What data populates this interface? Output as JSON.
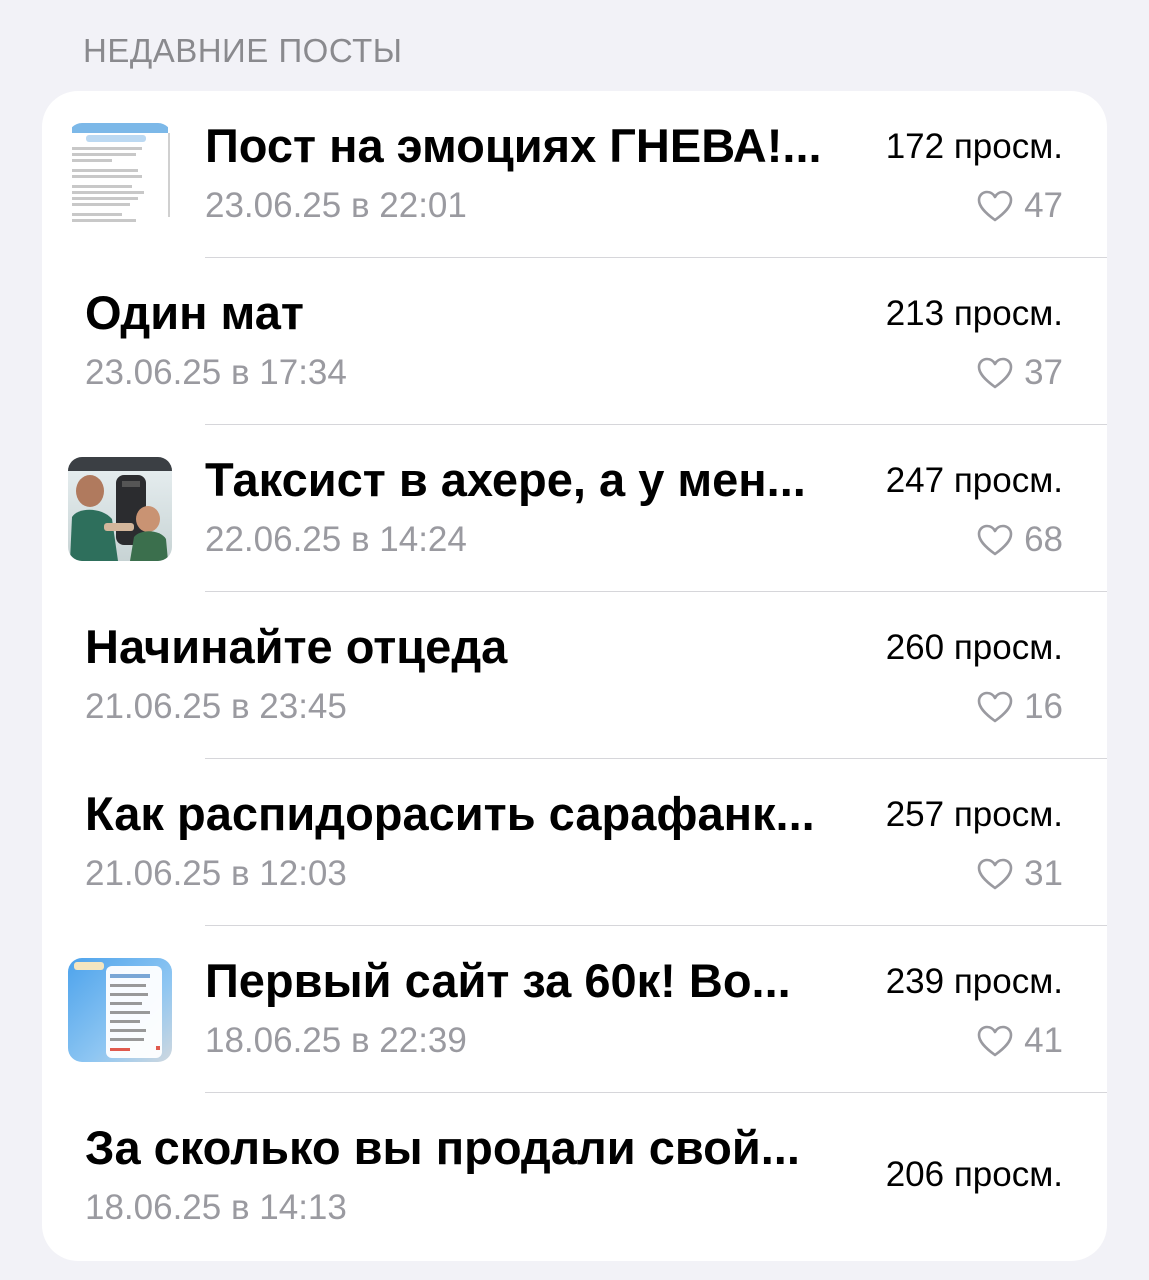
{
  "section": {
    "title": "НЕДАВНИЕ ПОСТЫ"
  },
  "posts": [
    {
      "title": "Пост на эмоциях ГНЕВА!...",
      "date": "23.06.25 в 22:01",
      "views": "172 просм.",
      "likes": "47",
      "thumb": "chat-screenshot"
    },
    {
      "title": "Один мат",
      "date": "23.06.25 в 17:34",
      "views": "213 просм.",
      "likes": "37",
      "thumb": null
    },
    {
      "title": "Таксист в ахере, а у мен...",
      "date": "22.06.25 в 14:24",
      "views": "247 просм.",
      "likes": "68",
      "thumb": "car-photo"
    },
    {
      "title": "Начинайте отцеда",
      "date": "21.06.25 в 23:45",
      "views": "260 просм.",
      "likes": "16",
      "thumb": null
    },
    {
      "title": "Как распидорасить сарафанк...",
      "date": "21.06.25 в 12:03",
      "views": "257 просм.",
      "likes": "31",
      "thumb": null
    },
    {
      "title": "Первый сайт за 60к! Во...",
      "date": "18.06.25 в 22:39",
      "views": "239 просм.",
      "likes": "41",
      "thumb": "menu-screenshot"
    },
    {
      "title": "За сколько вы продали свой...",
      "date": "18.06.25 в 14:13",
      "views": "206 просм.",
      "likes": null,
      "thumb": null
    }
  ]
}
